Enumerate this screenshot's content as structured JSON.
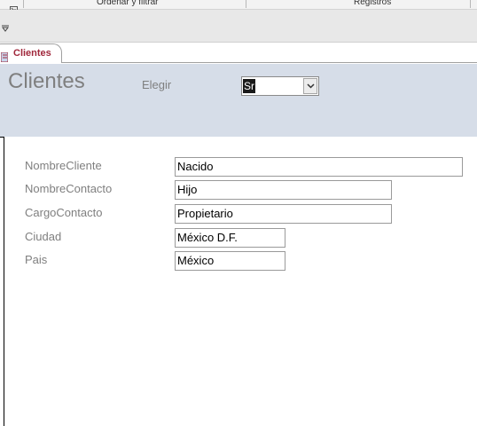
{
  "ribbon": {
    "groups": [
      {
        "label": "Ordenar y filtrar"
      },
      {
        "label": "Registros"
      }
    ]
  },
  "document_tab": {
    "label": "Clientes"
  },
  "form": {
    "title": "Clientes",
    "chooser": {
      "label": "Elegir",
      "value": "Sr"
    },
    "fields": [
      {
        "label": "NombreCliente",
        "value": "Nacido"
      },
      {
        "label": "NombreContacto",
        "value": "Hijo"
      },
      {
        "label": "CargoContacto",
        "value": "Propietario"
      },
      {
        "label": "Ciudad",
        "value": "México D.F."
      },
      {
        "label": "Pais",
        "value": "México"
      }
    ]
  },
  "colors": {
    "header_background": "#d6dde8",
    "tab_label": "#a0283c",
    "label_text": "#7f7f7f"
  }
}
